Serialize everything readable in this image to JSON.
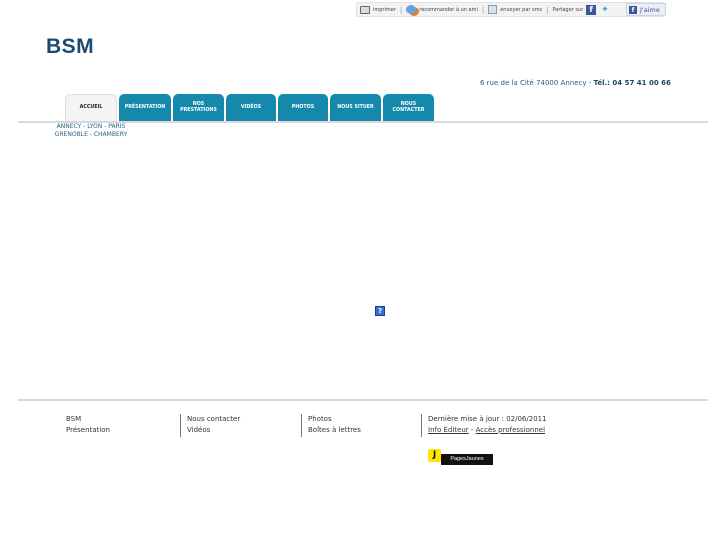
{
  "toolbar": {
    "print_label": "imprimer",
    "recommend_label": "recommander à un ami",
    "send_label": "envoyer par sms",
    "share_label": "Partager sur",
    "like_label": "J'aime"
  },
  "site": {
    "title": "BSM",
    "address": "6 rue de la Cité 74000 Annecy",
    "phone_label": "Tél.: 04 57 41 00 66",
    "dash": "-",
    "cities": [
      "ANNECY - LYON - PARIS",
      "GRENOBLE - CHAMBERY"
    ]
  },
  "nav": {
    "tabs": [
      {
        "label": "ACCUEIL",
        "active": true
      },
      {
        "label": "PRÉSENTATION"
      },
      {
        "label": "NOS\nPRESTATIONS"
      },
      {
        "label": "VIDÉOS"
      },
      {
        "label": "PHOTOS"
      },
      {
        "label": "NOUS SITUER"
      },
      {
        "label": "NOUS\nCONTACTER"
      }
    ]
  },
  "plugin": {
    "glyph": "?"
  },
  "footer": {
    "col1": [
      "BSM",
      "Présentation"
    ],
    "col2": [
      "Nous contacter",
      "Vidéos"
    ],
    "col3": [
      "Photos",
      "Boîtes à lettres"
    ],
    "col4": {
      "updated": "Dernière mise à jour : 02/06/2011",
      "info_link": "Info Éditeur",
      "link_sep": " - ",
      "pro_link": "Accès professionnel"
    },
    "badge": {
      "face": "J",
      "label": "PagesJaunes"
    }
  },
  "colors": {
    "tab": "#1489ac",
    "brand": "#1d4a72",
    "accent_text": "#27617f",
    "badge_yellow": "#ffe600"
  }
}
